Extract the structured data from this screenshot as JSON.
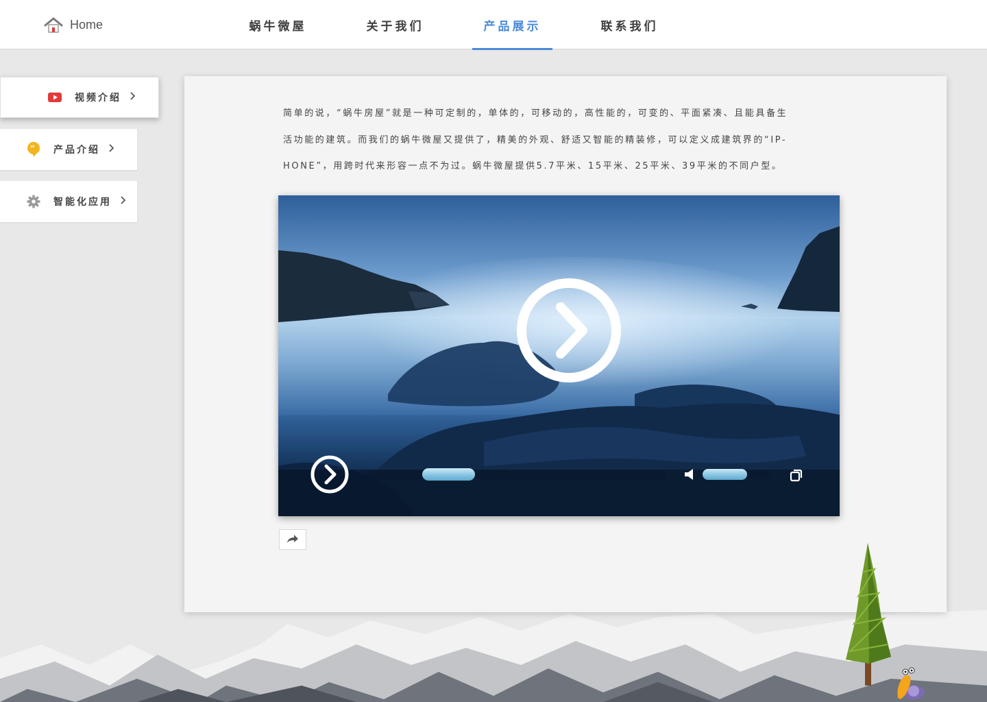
{
  "header": {
    "home_label": "Home",
    "nav": [
      {
        "label": "蜗牛微屋",
        "active": false
      },
      {
        "label": "关于我们",
        "active": false
      },
      {
        "label": "产品展示",
        "active": true
      },
      {
        "label": "联系我们",
        "active": false
      }
    ]
  },
  "sidebar": {
    "items": [
      {
        "label": "视频介绍",
        "icon": "youtube-icon",
        "active": true
      },
      {
        "label": "产品介绍",
        "icon": "quote-bubble-icon",
        "active": false
      },
      {
        "label": "智能化应用",
        "icon": "gear-icon",
        "active": false
      }
    ]
  },
  "main": {
    "intro_lines": [
      "简单的说，“蜗牛房屋”就是一种可定制的，单体的，可移动的，高性能的，可变的、平面紧凑、且能具备生",
      "活功能的建筑。而我们的蜗牛微屋又提供了，精美的外观、舒适又智能的精装修，可以定义成建筑界的“IP-",
      "HONE”，用跨时代来形容一点不为过。蜗牛微屋提供5.7平米、15平米、25平米、39平米的不同户型。"
    ],
    "video": {
      "progress": 0.19,
      "volume": 0.65
    }
  },
  "colors": {
    "accent": "#4a8ad8",
    "youtube_red": "#e03a3a",
    "quote_yellow": "#f2b51f",
    "gear_gray": "#9a9a9a"
  }
}
